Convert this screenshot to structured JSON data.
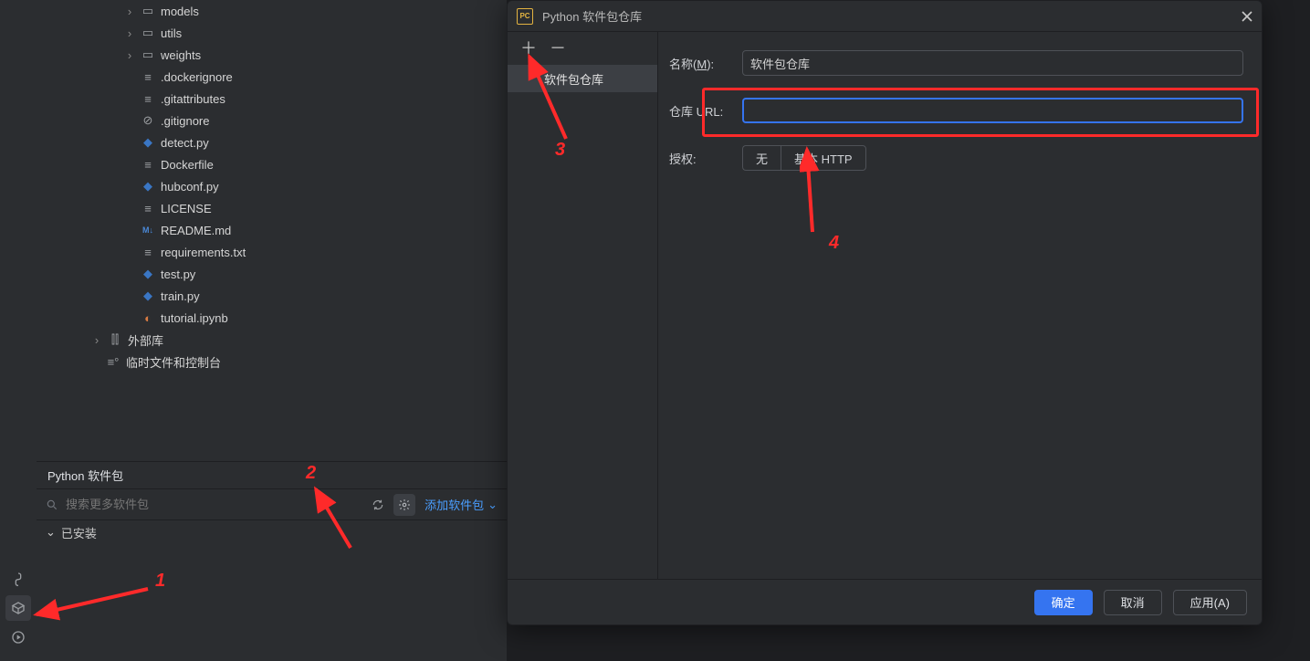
{
  "tree": {
    "models": "models",
    "utils": "utils",
    "weights": "weights",
    "dockerignore": ".dockerignore",
    "gitattributes": ".gitattributes",
    "gitignore": ".gitignore",
    "detect": "detect.py",
    "dockerfile": "Dockerfile",
    "hubconf": "hubconf.py",
    "license": "LICENSE",
    "readme": "README.md",
    "requirements": "requirements.txt",
    "test": "test.py",
    "train": "train.py",
    "tutorial": "tutorial.ipynb",
    "external_libs": "外部库",
    "scratches": "临时文件和控制台"
  },
  "bottom": {
    "title": "Python 软件包",
    "search_placeholder": "搜索更多软件包",
    "add_pkg": "添加软件包",
    "installed": "已安装"
  },
  "dialog": {
    "title": "Python 软件包仓库",
    "repo_item": "软件包仓库",
    "label_name": "名称(",
    "label_name_mnem": "M",
    "label_name_close": "):",
    "name_value": "软件包仓库",
    "label_url": "仓库 URL:",
    "url_value": "",
    "label_auth": "授权:",
    "auth_none": "无",
    "auth_basic": "基本 HTTP",
    "ok": "确定",
    "cancel": "取消",
    "apply": "应用(A)"
  },
  "anno": {
    "n1": "1",
    "n2": "2",
    "n3": "3",
    "n4": "4"
  }
}
